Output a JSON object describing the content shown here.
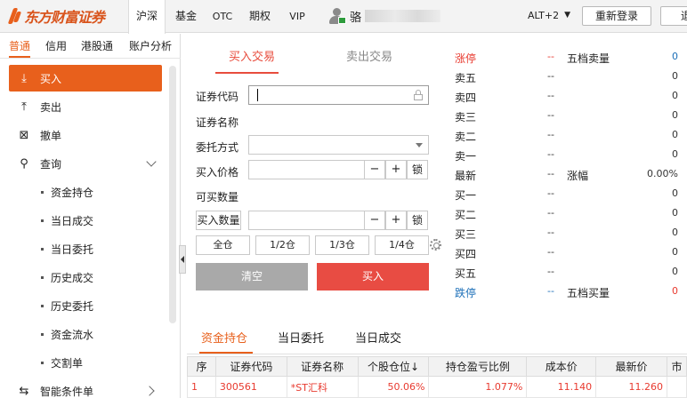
{
  "header": {
    "logo_text": "东方财富证券",
    "market_tabs": [
      "沪深",
      "基金",
      "OTC",
      "期权",
      "VIP"
    ],
    "active_market": "沪深",
    "user_name": "骆",
    "alt_label": "ALT+2",
    "alt_arrow": "▼",
    "relogin_label": "重新登录",
    "exit_label": "退"
  },
  "sidebar": {
    "tabs": [
      "普通",
      "信用",
      "港股通",
      "账户分析"
    ],
    "items": [
      {
        "label": "买入",
        "icon": "download-icon",
        "glyph": "⤓"
      },
      {
        "label": "卖出",
        "icon": "upload-icon",
        "glyph": "⤒"
      },
      {
        "label": "撤单",
        "icon": "cancel-order-icon",
        "glyph": "⊠"
      },
      {
        "label": "查询",
        "icon": "search-icon",
        "glyph": "⚲"
      }
    ],
    "sub_items": [
      "资金持仓",
      "当日成交",
      "当日委托",
      "历史成交",
      "历史委托",
      "资金流水",
      "交割单"
    ],
    "last_item": {
      "label": "智能条件单",
      "icon": "smart-order-icon",
      "glyph": "⇆"
    }
  },
  "trade": {
    "tab_buy": "买入交易",
    "tab_sell": "卖出交易",
    "code_label": "证券代码",
    "name_label": "证券名称",
    "order_type_label": "委托方式",
    "price_label": "买入价格",
    "qty_avail_label": "可买数量",
    "qty_button": "买入数量",
    "minus": "−",
    "plus": "+",
    "lock": "锁",
    "positions": [
      "全仓",
      "1/2仓",
      "1/3仓",
      "1/4仓"
    ],
    "clear_label": "清空",
    "buy_label": "买入"
  },
  "quote": {
    "limit_up": "涨停",
    "limit_down": "跌停",
    "sell5_title": "五档卖量",
    "buy5_title": "五档买量",
    "change_label": "涨幅",
    "change_value": "0.00%",
    "latest": "最新",
    "dash": "--",
    "zero": "0",
    "sell_levels": [
      "卖五",
      "卖四",
      "卖三",
      "卖二",
      "卖一"
    ],
    "buy_levels": [
      "买一",
      "买二",
      "买三",
      "买四",
      "买五"
    ],
    "colors": {
      "red": "#e83a2f",
      "blue": "#1c6fb8"
    }
  },
  "bottom": {
    "tabs": [
      "资金持仓",
      "当日委托",
      "当日成交"
    ],
    "columns": [
      "序",
      "证券代码",
      "证券名称",
      "个股仓位↓",
      "持仓盈亏比例",
      "成本价",
      "最新价",
      "市"
    ],
    "rows": [
      [
        "1",
        "300561",
        "*ST汇科",
        "50.06%",
        "1.077%",
        "11.140",
        "11.260",
        ""
      ]
    ]
  }
}
